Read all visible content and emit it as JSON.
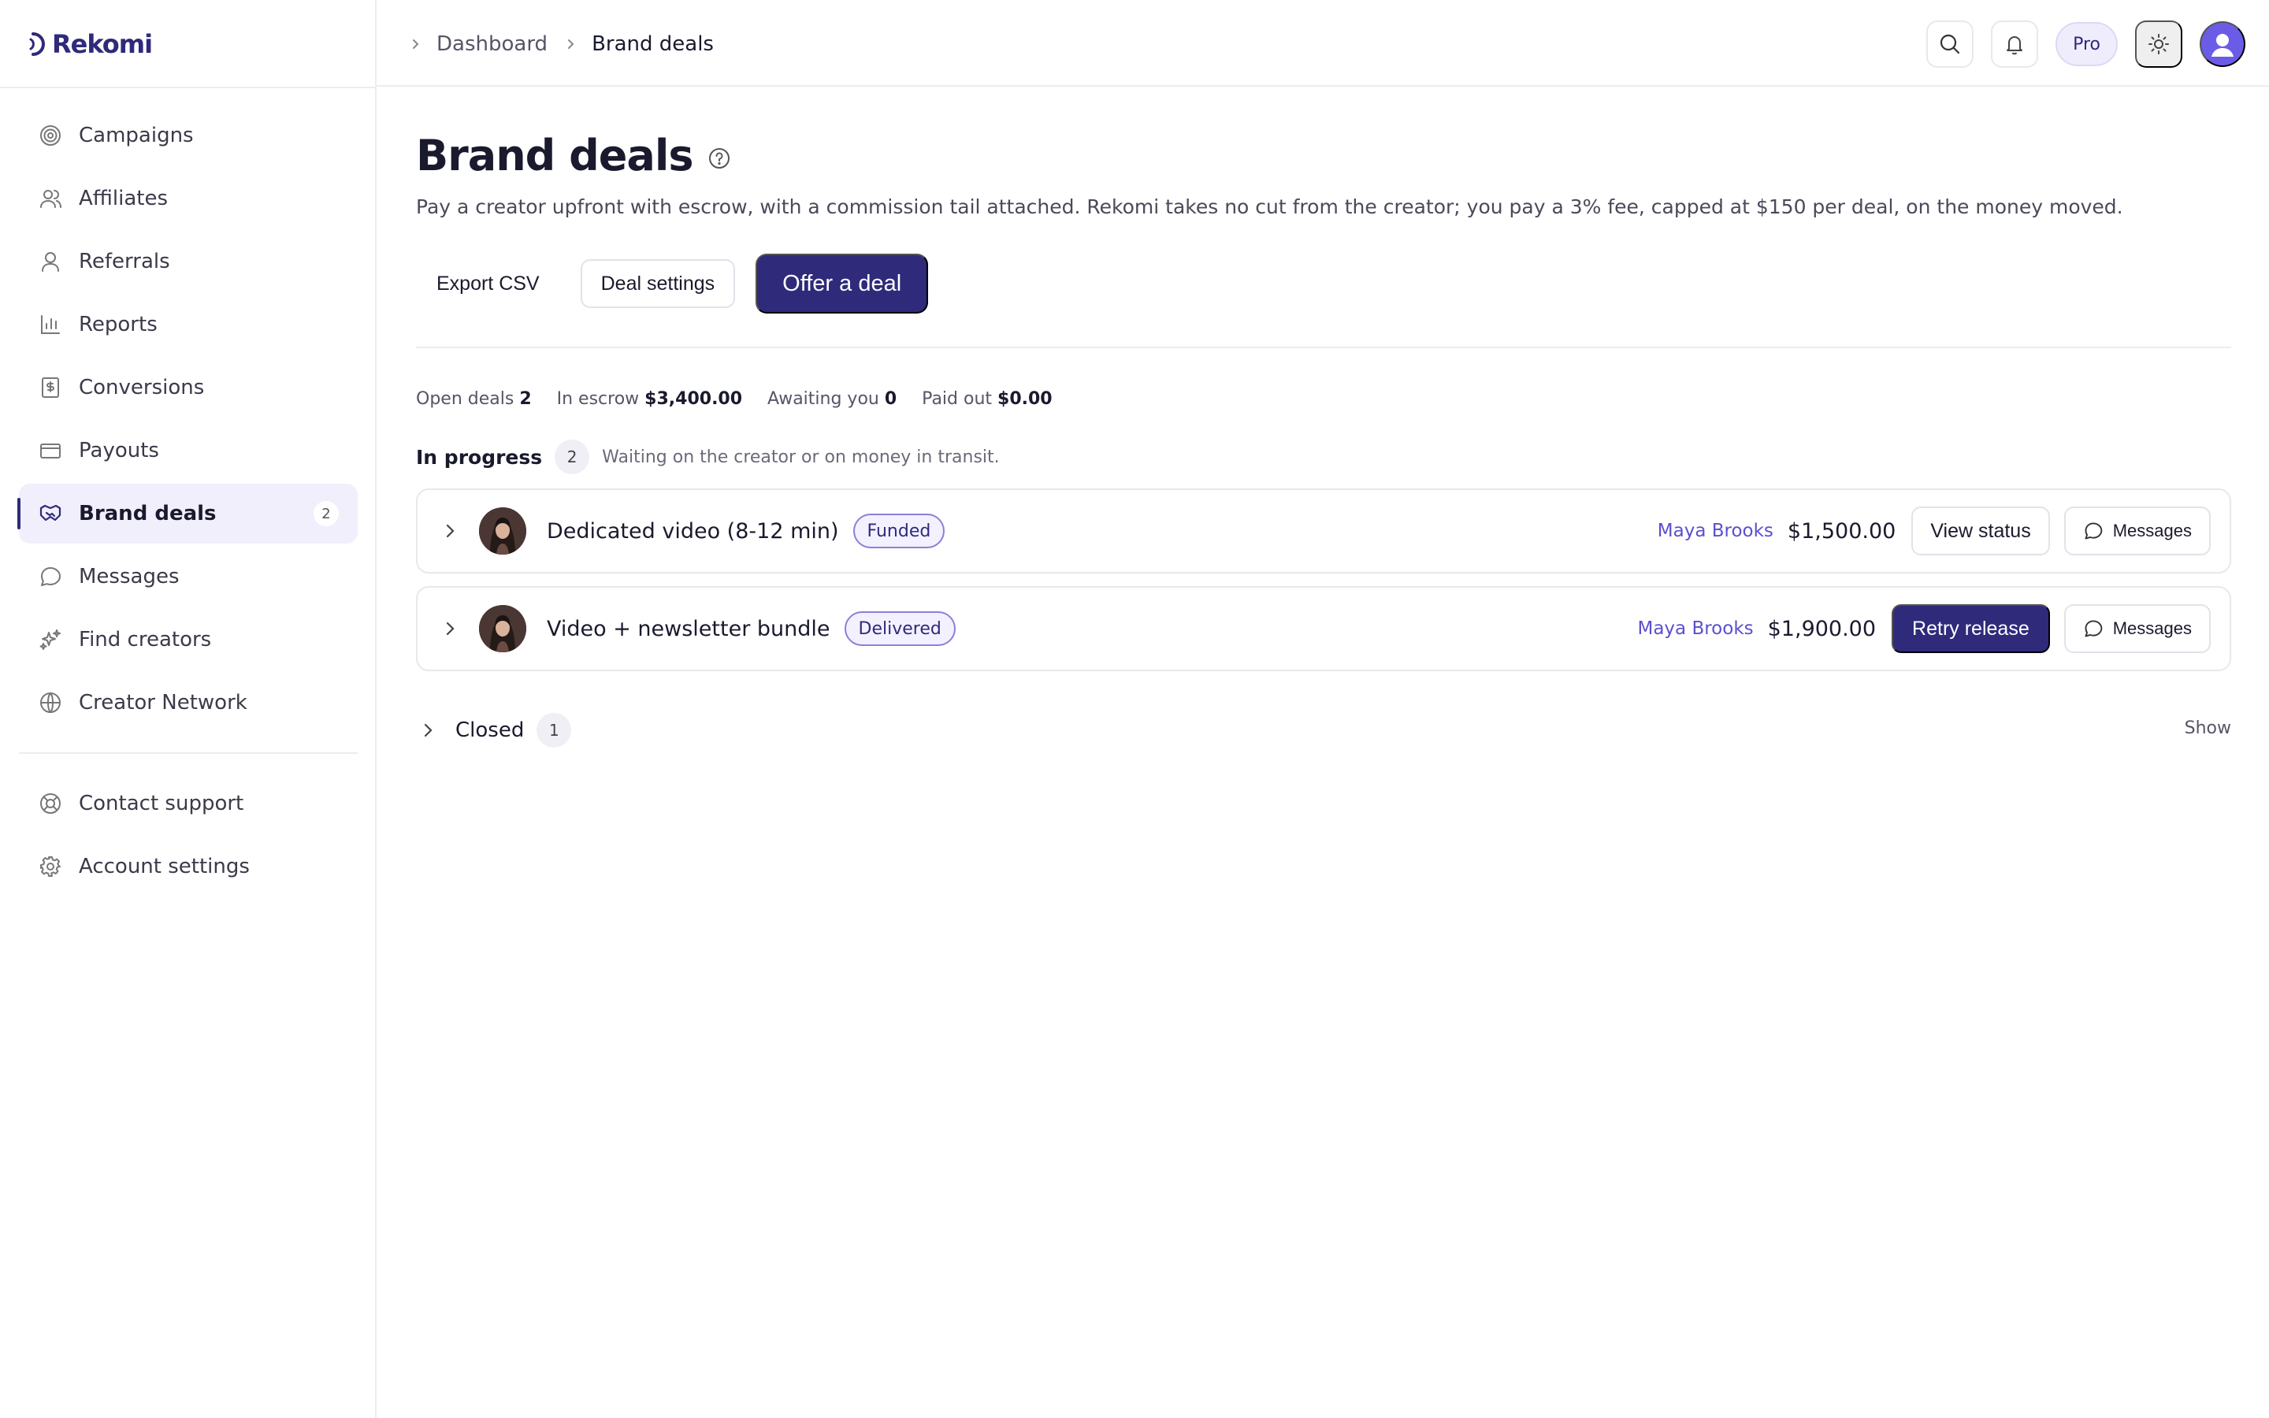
{
  "app": {
    "name": "Rekomi"
  },
  "breadcrumb": {
    "parent": "Dashboard",
    "current": "Brand deals"
  },
  "topbar": {
    "plan_badge": "Pro"
  },
  "sidebar": {
    "items": [
      {
        "label": "Campaigns",
        "icon": "target-icon"
      },
      {
        "label": "Affiliates",
        "icon": "users-icon"
      },
      {
        "label": "Referrals",
        "icon": "user-icon"
      },
      {
        "label": "Reports",
        "icon": "bar-chart-icon"
      },
      {
        "label": "Conversions",
        "icon": "receipt-dollar-icon"
      },
      {
        "label": "Payouts",
        "icon": "credit-card-icon"
      },
      {
        "label": "Brand deals",
        "icon": "handshake-icon",
        "count": "2",
        "active": true
      },
      {
        "label": "Messages",
        "icon": "chat-bubble-icon"
      },
      {
        "label": "Find creators",
        "icon": "sparkle-icon"
      },
      {
        "label": "Creator Network",
        "icon": "globe-icon"
      }
    ],
    "bottom": [
      {
        "label": "Contact support",
        "icon": "lifebuoy-icon"
      },
      {
        "label": "Account settings",
        "icon": "gear-icon"
      }
    ]
  },
  "page": {
    "title": "Brand deals",
    "description": "Pay a creator upfront with escrow, with a commission tail attached. Rekomi takes no cut from the creator; you pay a 3% fee, capped at $150 per deal, on the money moved.",
    "actions": {
      "export": "Export CSV",
      "settings": "Deal settings",
      "offer": "Offer a deal"
    }
  },
  "stats": [
    {
      "label": "Open deals",
      "value": "2"
    },
    {
      "label": "In escrow",
      "value": "$3,400.00"
    },
    {
      "label": "Awaiting you",
      "value": "0"
    },
    {
      "label": "Paid out",
      "value": "$0.00"
    }
  ],
  "in_progress": {
    "title": "In progress",
    "count": "2",
    "note": "Waiting on the creator or on money in transit.",
    "deals": [
      {
        "title": "Dedicated video (8-12 min)",
        "status": "Funded",
        "creator": "Maya Brooks",
        "amount": "$1,500.00",
        "action": "View status",
        "action_style": "outline",
        "messages": "Messages"
      },
      {
        "title": "Video + newsletter bundle",
        "status": "Delivered",
        "creator": "Maya Brooks",
        "amount": "$1,900.00",
        "action": "Retry release",
        "action_style": "primary",
        "messages": "Messages"
      }
    ]
  },
  "closed": {
    "title": "Closed",
    "count": "1",
    "toggle": "Show"
  },
  "colors": {
    "brand": "#2f2a7a",
    "accent": "#5b4fcf",
    "avatar": "#6b5ce7"
  }
}
